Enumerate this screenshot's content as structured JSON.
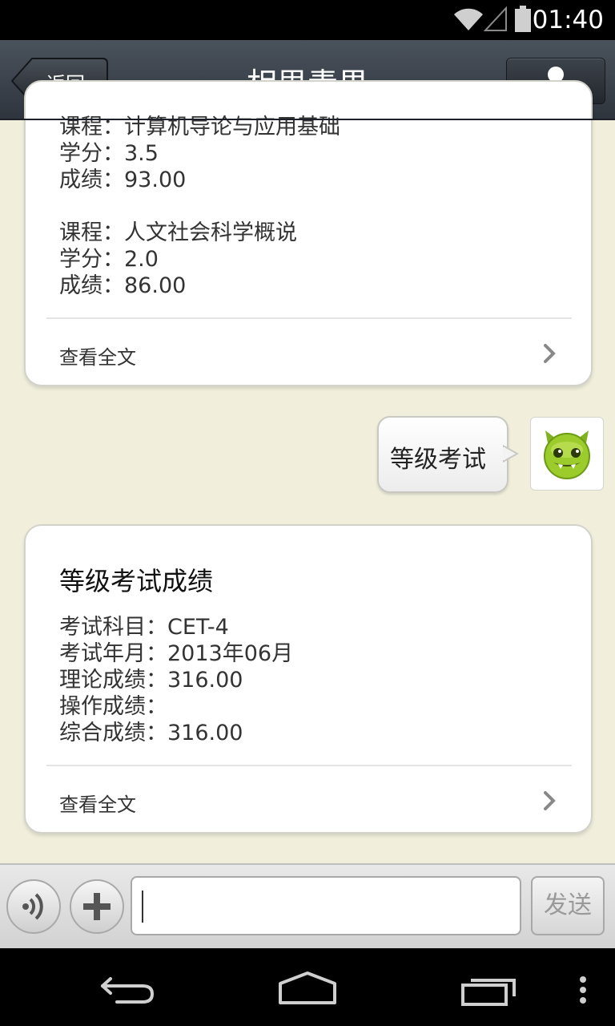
{
  "status": {
    "time": "01:40",
    "wifi_icon": "wifi-icon",
    "signal_icon": "signal-icon",
    "battery_icon": "battery-icon"
  },
  "header": {
    "back_label": "返回",
    "title": "相思青果",
    "profile_icon": "person-icon"
  },
  "card1": {
    "lines": [
      "课程：计算机导论与应用基础",
      "学分：3.5",
      "成绩：93.00",
      "",
      "课程：人文社会科学概说",
      "学分：2.0",
      "成绩：86.00"
    ],
    "more_label": "查看全文"
  },
  "sent_message": {
    "text": "等级考试",
    "avatar_icon": "green-monster-avatar"
  },
  "card2": {
    "title": "等级考试成绩",
    "lines": [
      "考试科目：CET-4",
      "考试年月：2013年06月",
      "理论成绩：316.00",
      "操作成绩：",
      "综合成绩：316.00"
    ],
    "more_label": "查看全文"
  },
  "input": {
    "value": "",
    "placeholder": "",
    "send_label": "发送"
  },
  "colors": {
    "background": "#f1efdc",
    "titlebar": "#3a4149",
    "card": "#ffffff"
  }
}
